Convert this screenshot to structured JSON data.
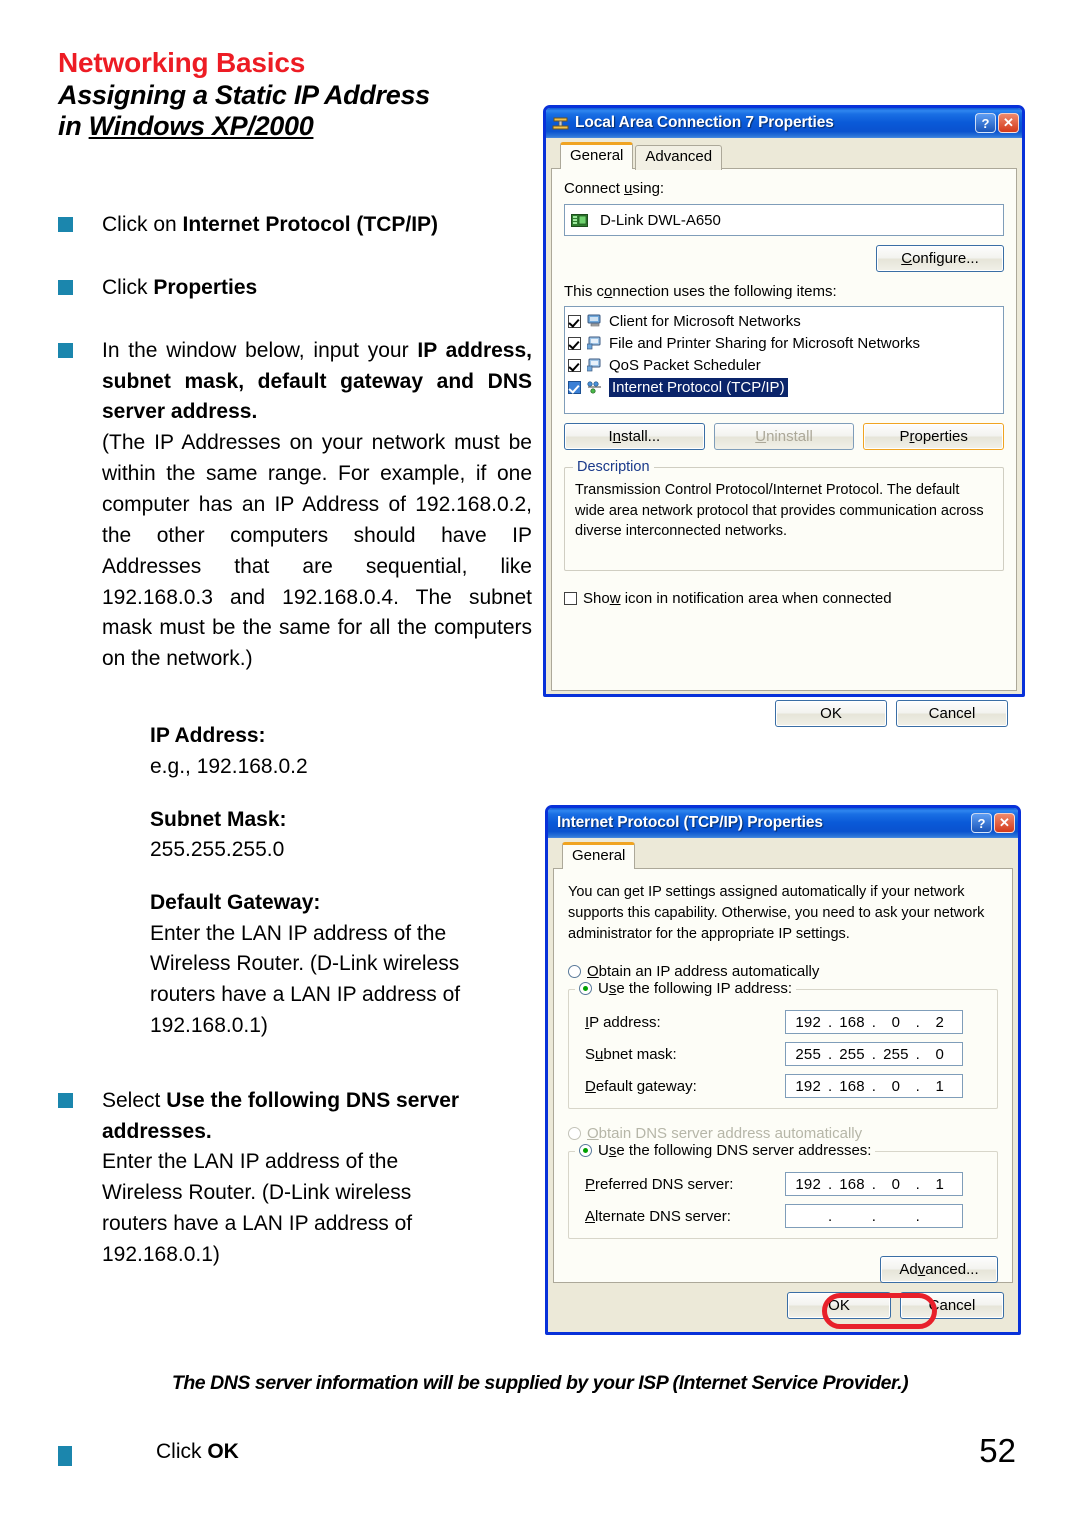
{
  "header": {
    "kicker": "Networking Basics",
    "title_line1": "Assigning a Static IP Address",
    "title_line2_prefix": "in ",
    "title_line2_underlined": "Windows XP/2000"
  },
  "instructions": {
    "b1_plain": "Click on ",
    "b1_bold": "Internet Protocol (TCP/IP)",
    "b2_plain": "Click ",
    "b2_bold": "Properties",
    "b3_plain": " In the window below, input your ",
    "b3_bold": "IP address, subnet mask, default gateway and DNS server address.",
    "b3_tail": "(The IP Addresses on your network must be within the same range. For example, if one computer has an IP Address of 192.168.0.2, the other computers should have IP Addresses that are sequential, like 192.168.0.3 and 192.168.0.4.  The subnet mask must be the same for all the computers on the network.)"
  },
  "settings": {
    "ip_label": "IP Address:",
    "ip_value": "e.g., 192.168.0.2",
    "mask_label": "Subnet Mask:",
    "mask_value": "255.255.255.0",
    "gateway_label": "Default Gateway:",
    "gateway_value": "Enter the LAN IP address of the Wireless Router. (D-Link wireless routers have a LAN IP address of 192.168.0.1)"
  },
  "dns_bullet": {
    "plain": "Select ",
    "bold": "Use the following DNS server addresses.",
    "tail": "Enter the LAN IP address of the Wireless Router. (D-Link wireless routers have a LAN IP address of 192.168.0.1)"
  },
  "footnote": "The DNS server information will be supplied by your ISP (Internet Service Provider.)",
  "footer": {
    "click_plain": "Click ",
    "click_bold": "OK",
    "page_number": "52"
  },
  "dialog1": {
    "title": "Local Area Connection 7 Properties",
    "help_btn": "?",
    "close_btn": "✕",
    "tabs": [
      {
        "label": "General",
        "active": true
      },
      {
        "label": "Advanced",
        "active": false
      }
    ],
    "connect_using_label": "Connect using:",
    "adapter": "D-Link DWL-A650",
    "configure_button": "Configure...",
    "items_label": "This connection uses the following items:",
    "items": [
      {
        "label": "Client for Microsoft Networks",
        "checked": true,
        "selected": false
      },
      {
        "label": "File and Printer Sharing for Microsoft Networks",
        "checked": true,
        "selected": false
      },
      {
        "label": "QoS Packet Scheduler",
        "checked": true,
        "selected": false
      },
      {
        "label": "Internet Protocol (TCP/IP)",
        "checked": true,
        "selected": true
      }
    ],
    "install_button": "Install...",
    "uninstall_button": "Uninstall",
    "properties_button": "Properties",
    "description_legend": "Description",
    "description_text": "Transmission Control Protocol/Internet Protocol. The default wide area network protocol that provides communication across diverse interconnected networks.",
    "show_icon_checkbox": "Show icon in notification area when connected",
    "show_icon_checked": false,
    "ok_button": "OK",
    "cancel_button": "Cancel"
  },
  "dialog2": {
    "title": "Internet Protocol (TCP/IP) Properties",
    "help_btn": "?",
    "close_btn": "✕",
    "tabs": [
      {
        "label": "General",
        "active": true
      }
    ],
    "intro": "You can get IP settings assigned automatically if your network supports this capability. Otherwise, you need to ask your network administrator for the appropriate IP settings.",
    "radio_obtain_ip": "Obtain an IP address automatically",
    "radio_use_ip": "Use the following IP address:",
    "ip_label": "IP address:",
    "ip_value": [
      "192",
      "168",
      "0",
      "2"
    ],
    "mask_label": "Subnet mask:",
    "mask_value": [
      "255",
      "255",
      "255",
      "0"
    ],
    "gateway_label": "Default gateway:",
    "gateway_value": [
      "192",
      "168",
      "0",
      "1"
    ],
    "radio_obtain_dns": "Obtain DNS server address automatically",
    "radio_use_dns": "Use the following DNS server addresses:",
    "preferred_dns_label": "Preferred DNS server:",
    "preferred_dns_value": [
      "192",
      "168",
      "0",
      "1"
    ],
    "alternate_dns_label": "Alternate DNS server:",
    "alternate_dns_value": [
      "",
      "",
      "",
      ""
    ],
    "advanced_button": "Advanced...",
    "ok_button": "OK",
    "cancel_button": "Cancel"
  },
  "colors": {
    "kicker_red": "#ed1c24",
    "bullet_teal": "#1b86ad",
    "annotation_red": "#e8202a",
    "titlebar_blue": "#0a5ad8"
  }
}
